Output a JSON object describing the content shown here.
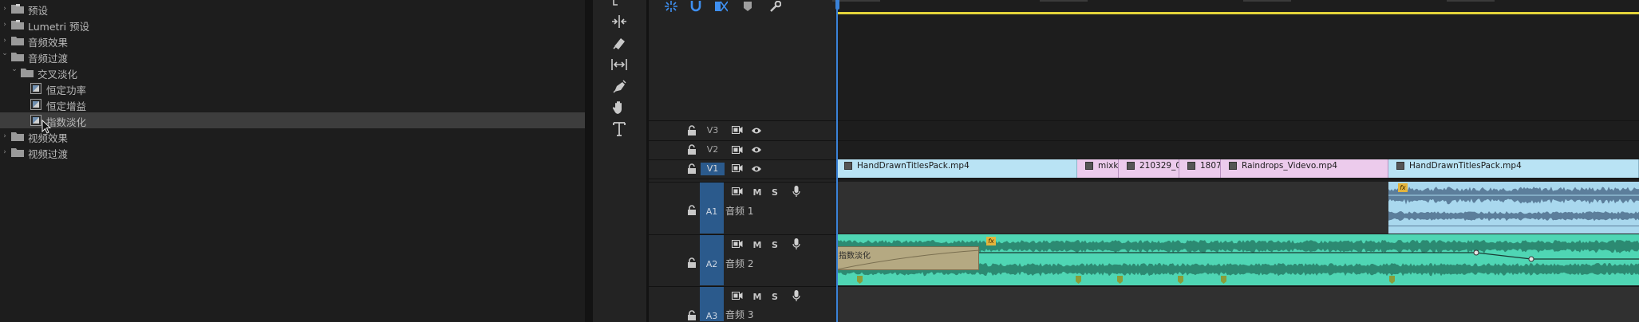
{
  "effects_panel": {
    "items": [
      {
        "label": "预设",
        "level": 0,
        "type": "preset-folder",
        "expanded": false
      },
      {
        "label": "Lumetri 预设",
        "level": 0,
        "type": "preset-folder",
        "expanded": false
      },
      {
        "label": "音频效果",
        "level": 0,
        "type": "folder",
        "expanded": false
      },
      {
        "label": "音频过渡",
        "level": 0,
        "type": "folder",
        "expanded": true
      },
      {
        "label": "交叉淡化",
        "level": 1,
        "type": "folder",
        "expanded": true
      },
      {
        "label": "恒定功率",
        "level": 2,
        "type": "effect"
      },
      {
        "label": "恒定增益",
        "level": 2,
        "type": "effect"
      },
      {
        "label": "指数淡化",
        "level": 2,
        "type": "effect",
        "selected": true
      },
      {
        "label": "视频效果",
        "level": 0,
        "type": "folder",
        "expanded": false
      },
      {
        "label": "视频过渡",
        "level": 0,
        "type": "folder",
        "expanded": false
      }
    ]
  },
  "tools": [
    "selection-tool",
    "ripple-edit-tool",
    "razor-tool",
    "slip-tool",
    "pen-tool",
    "hand-tool",
    "type-tool"
  ],
  "timeline": {
    "toolbar": [
      "snap-icon",
      "linked-selection-icon",
      "marker-icon",
      "settings-wrench-icon"
    ],
    "video_tracks": [
      {
        "name": "V3",
        "target": false
      },
      {
        "name": "V2",
        "target": false
      },
      {
        "name": "V1",
        "target": true
      }
    ],
    "audio_tracks": [
      {
        "name": "A1",
        "label": "音频 1",
        "m": "M",
        "s": "S"
      },
      {
        "name": "A2",
        "label": "音频 2",
        "m": "M",
        "s": "S"
      },
      {
        "name": "A3",
        "label": "音频 3",
        "m": "M",
        "s": "S"
      }
    ],
    "v1_clips": [
      {
        "name": "HandDrawnTitlesPack.mp4",
        "color": "video"
      },
      {
        "name": "mixk",
        "color": "pink"
      },
      {
        "name": "210329_0",
        "color": "pink"
      },
      {
        "name": "1807",
        "color": "pink"
      },
      {
        "name": "Raindrops_Videvo.mp4",
        "color": "pink"
      },
      {
        "name": "HandDrawnTitlesPack.mp4",
        "color": "video"
      }
    ],
    "transition_label": "指数淡化",
    "fx_badge": "fx",
    "colors": {
      "video_clip": "#b9e3f4",
      "pink_clip": "#eccbec",
      "audio_teal": "#4fd6b4",
      "audio_blue": "#a9d8ee",
      "playhead": "#3a82d8",
      "work_area": "#e2d33a"
    }
  }
}
